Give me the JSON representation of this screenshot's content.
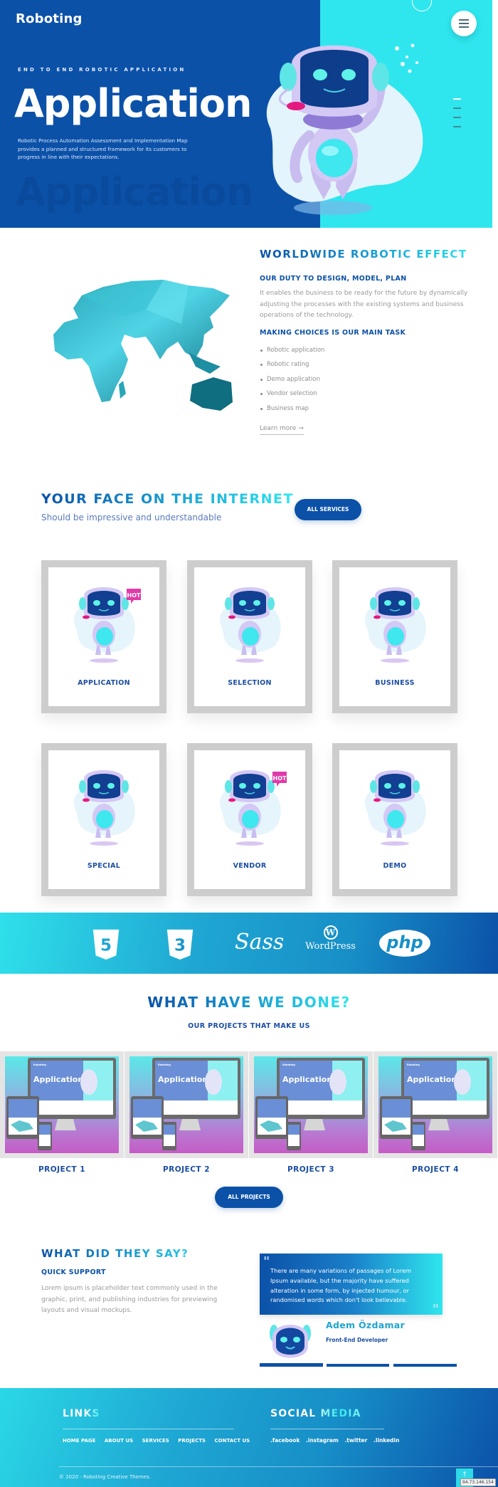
{
  "brand": {
    "logo": "Roboting",
    "primary": "#0b51a8",
    "accent": "#2fe6ee"
  },
  "hero": {
    "kicker": "END TO END ROBOTIC APPLICATION",
    "title": "Application",
    "description": "Robotic Process Automation Assessment and Implementation Map provides a planned and structured framework for its customers to progress in line with their expectations.",
    "ghost_title": "Application",
    "menu_icon": "hamburger-icon",
    "slider": {
      "count": 4,
      "active": 1
    }
  },
  "worldwide": {
    "title": "WORLDWIDE ROBOTIC EFFECT",
    "duty_heading": "OUR DUTY TO DESIGN, MODEL, PLAN",
    "duty_text": "It enables the business to be ready for the future by dynamically adjusting the processes with the existing systems and business operations of the technology.",
    "choices_heading": "MAKING CHOICES IS OUR MAIN TASK",
    "list": [
      "Robotic application",
      "Robotic rating",
      "Demo application",
      "Vendor selection",
      "Business map"
    ],
    "learn_more": "Learn more →"
  },
  "services": {
    "title": "YOUR FACE ON THE INTERNET",
    "subtitle": "Should be impressive and understandable",
    "button": "ALL SERVICES",
    "cards": [
      {
        "label": "APPLICATION",
        "badge": "HOT"
      },
      {
        "label": "SELECTION",
        "badge": ""
      },
      {
        "label": "BUSINESS",
        "badge": ""
      },
      {
        "label": "SPECIAL",
        "badge": ""
      },
      {
        "label": "VENDOR",
        "badge": "HOT"
      },
      {
        "label": "DEMO",
        "badge": ""
      }
    ]
  },
  "tech": {
    "logos": [
      {
        "name": "HTML5",
        "icon": "html5-icon",
        "glyph": "5"
      },
      {
        "name": "CSS3",
        "icon": "css3-icon",
        "glyph": "3"
      },
      {
        "name": "Sass",
        "icon": "sass-icon",
        "glyph": "Sass"
      },
      {
        "name": "WordPress",
        "icon": "wordpress-icon",
        "glyph": "WordPress"
      },
      {
        "name": "PHP",
        "icon": "php-icon",
        "glyph": "php"
      }
    ]
  },
  "projects": {
    "title": "WHAT HAVE WE DONE?",
    "subtitle": "OUR PROJECTS THAT MAKE US",
    "items": [
      {
        "label": "PROJECT 1",
        "mock_title": "Application",
        "mock_logo": "Roboting"
      },
      {
        "label": "PROJECT 2",
        "mock_title": "Application",
        "mock_logo": "Roboting"
      },
      {
        "label": "PROJECT 3",
        "mock_title": "Application",
        "mock_logo": "Roboting"
      },
      {
        "label": "PROJECT 4",
        "mock_title": "Application",
        "mock_logo": "Roboting"
      }
    ],
    "button": "ALL PROJECTS"
  },
  "testimonials": {
    "title": "WHAT DID THEY SAY?",
    "heading": "QUICK SUPPORT",
    "text": "Lorem ipsum is placeholder text commonly used in the graphic, print, and publishing industries for previewing layouts and visual mockups.",
    "quote": "There are many variations of passages of Lorem Ipsum available, but the majority have suffered alteration in some form, by injected humour, or randomised words which don't look believable.",
    "quote_mark": "\"",
    "person": {
      "name": "Adem Özdamar",
      "role": "Front-End Developer"
    },
    "tabs": {
      "count": 3,
      "active": 1
    }
  },
  "footer": {
    "links_title": "LINKS",
    "links": [
      "HOME PAGE",
      "ABOUT US",
      "SERVICES",
      "PROJECTS",
      "CONTACT US"
    ],
    "social_title": "SOCIAL MEDIA",
    "social": [
      ".facebook",
      ".instagram",
      ".twitter",
      ".linkedin"
    ],
    "copyright": "© 2020 - Roboting Creative Themes.",
    "to_top_icon": "↑",
    "ip_tag": "94.73.146.154"
  }
}
